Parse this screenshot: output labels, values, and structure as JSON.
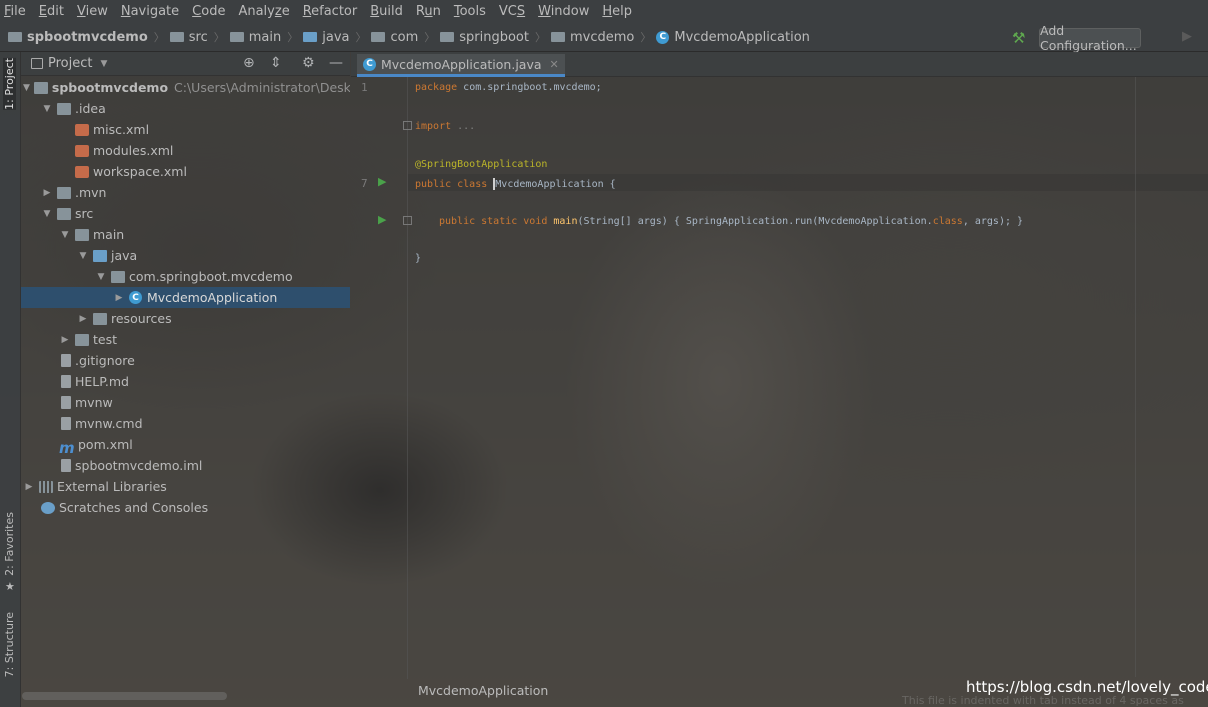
{
  "menu": {
    "items": [
      {
        "u": "F",
        "rest": "ile"
      },
      {
        "u": "E",
        "rest": "dit"
      },
      {
        "u": "V",
        "rest": "iew"
      },
      {
        "u": "N",
        "rest": "avigate"
      },
      {
        "u": "C",
        "rest": "ode"
      },
      {
        "pre": "Analy",
        "u": "z",
        "rest": "e"
      },
      {
        "u": "R",
        "rest": "efactor"
      },
      {
        "u": "B",
        "rest": "uild"
      },
      {
        "pre": "R",
        "u": "u",
        "rest": "n"
      },
      {
        "u": "T",
        "rest": "ools"
      },
      {
        "pre": "VC",
        "u": "S",
        "rest": ""
      },
      {
        "u": "W",
        "rest": "indow"
      },
      {
        "u": "H",
        "rest": "elp"
      }
    ]
  },
  "navbar": {
    "crumbs": [
      "spbootmvcdemo",
      "src",
      "main",
      "java",
      "com",
      "springboot",
      "mvcdemo",
      "MvcdemoApplication"
    ],
    "add_configuration": "Add Configuration..."
  },
  "left_stripe": {
    "project": "1: Project",
    "favorites": "2: Favorites",
    "structure": "7: Structure"
  },
  "project_panel": {
    "title": "Project",
    "tree": [
      {
        "label": "spbootmvcdemo",
        "extra": "C:\\Users\\Administrator\\Desktop",
        "bold": true
      },
      {
        "label": ".idea"
      },
      {
        "label": "misc.xml"
      },
      {
        "label": "modules.xml"
      },
      {
        "label": "workspace.xml"
      },
      {
        "label": ".mvn"
      },
      {
        "label": "src"
      },
      {
        "label": "main"
      },
      {
        "label": "java"
      },
      {
        "label": "com.springboot.mvcdemo"
      },
      {
        "label": "MvcdemoApplication"
      },
      {
        "label": "resources"
      },
      {
        "label": "test"
      },
      {
        "label": ".gitignore"
      },
      {
        "label": "HELP.md"
      },
      {
        "label": "mvnw"
      },
      {
        "label": "mvnw.cmd"
      },
      {
        "label": "pom.xml"
      },
      {
        "label": "spbootmvcdemo.iml"
      },
      {
        "label": "External Libraries"
      },
      {
        "label": "Scratches and Consoles"
      }
    ]
  },
  "editor": {
    "tab_label": "MvcdemoApplication.java",
    "line_numbers": [
      "1",
      "7"
    ],
    "code": {
      "line1_kw": "package",
      "line1_rest": " com.springboot.mvcdemo;",
      "import_kw": "import",
      "import_rest": " ...",
      "annotation": "@SpringBootApplication",
      "class_kw": "public class ",
      "class_name": "MvcdemoApplication",
      "class_brace": " {",
      "main_kw": "public static void ",
      "main_fn": "main",
      "main_params": "(String[] args) ",
      "main_body_open": "{ SpringApplication.",
      "main_run": "run",
      "main_args": "(MvcdemoApplication.",
      "main_class_kw": "class",
      "main_end": ", args); }",
      "closing": "}"
    },
    "bottom_breadcrumb": "MvcdemoApplication"
  },
  "watermark": "https://blog.csdn.net/lovely_code",
  "status_hint": "This file is indented with tab instead of 4 spaces as"
}
